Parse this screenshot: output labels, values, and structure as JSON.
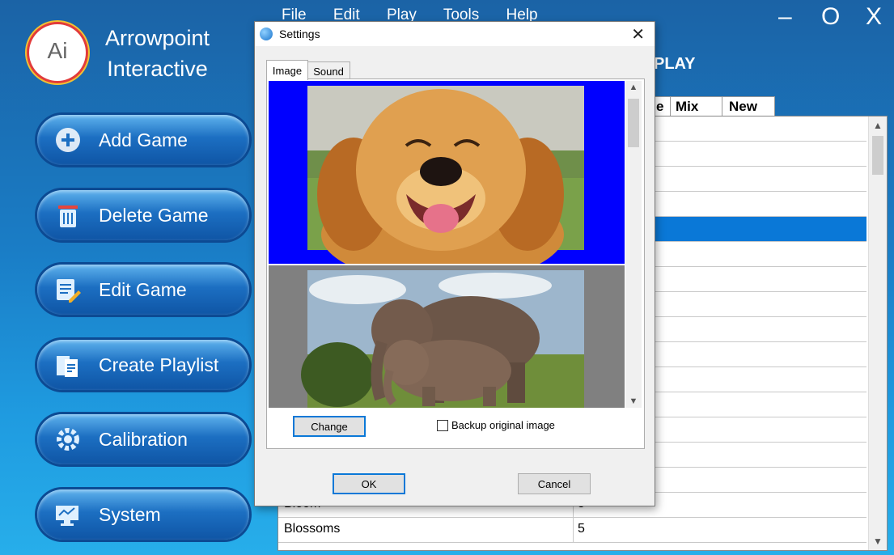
{
  "brand": {
    "logo_text": "Ai",
    "line1": "Arrowpoint",
    "line2": "Interactive"
  },
  "menu": [
    "File",
    "Edit",
    "Play",
    "Tools",
    "Help"
  ],
  "window_controls": {
    "minimize": "–",
    "maximize": "O",
    "close": "X"
  },
  "playing_label": "PLAY",
  "side_buttons": [
    {
      "label": "Add Game",
      "icon": "plus-icon"
    },
    {
      "label": "Delete Game",
      "icon": "trash-icon"
    },
    {
      "label": "Edit Game",
      "icon": "edit-icon"
    },
    {
      "label": "Create Playlist",
      "icon": "playlist-icon"
    },
    {
      "label": "Calibration",
      "icon": "calibration-icon"
    },
    {
      "label": "System",
      "icon": "system-icon"
    }
  ],
  "list_tabs": [
    "e",
    "Mix",
    "New"
  ],
  "list_rows": [
    {
      "name": "Bloom",
      "value": "5"
    },
    {
      "name": "Blossoms",
      "value": "5"
    }
  ],
  "dialog": {
    "title": "Settings",
    "close": "✕",
    "tabs": [
      "Image",
      "Sound"
    ],
    "change_label": "Change",
    "backup_label": "Backup original image",
    "ok_label": "OK",
    "cancel_label": "Cancel"
  },
  "colors": {
    "selected_row": "#0a78d7",
    "image_bg_1": "#0000ff",
    "image_bg_2": "#808080"
  }
}
